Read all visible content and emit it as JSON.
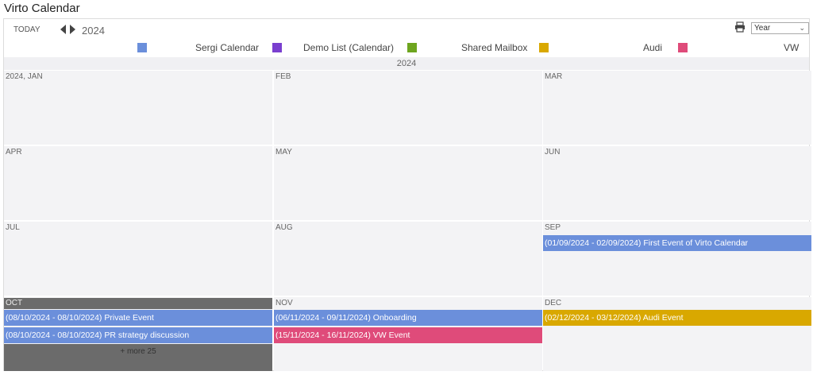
{
  "app": {
    "title": "Virto Calendar"
  },
  "toolbar": {
    "today_label": "TODAY",
    "year": "2024",
    "view_selected": "Year"
  },
  "legend": [
    {
      "label": "Sergi Calendar",
      "color": "#6b8fdb"
    },
    {
      "label": "Demo List (Calendar)",
      "color": "#7a3fcf"
    },
    {
      "label": "Shared Mailbox",
      "color": "#6ea51f"
    },
    {
      "label": "Audi",
      "color": "#d9a800"
    },
    {
      "label": "VW",
      "color": "#df4b7a"
    }
  ],
  "year_header": "2024",
  "months": [
    {
      "label": "2024, JAN"
    },
    {
      "label": "FEB"
    },
    {
      "label": "MAR"
    },
    {
      "label": "APR"
    },
    {
      "label": "MAY"
    },
    {
      "label": "JUN"
    },
    {
      "label": "JUL"
    },
    {
      "label": "AUG"
    },
    {
      "label": "SEP"
    },
    {
      "label": "OCT"
    },
    {
      "label": "NOV"
    },
    {
      "label": "DEC"
    }
  ],
  "events": {
    "sep": [
      {
        "dates": "(01/09/2024 - 02/09/2024)",
        "title": "First Event of Virto Calendar",
        "color": "#6b8fdb"
      }
    ],
    "oct": [
      {
        "dates": "(08/10/2024 - 08/10/2024)",
        "title": "Private Event",
        "color": "#6b8fdb"
      },
      {
        "dates": "(08/10/2024 - 08/10/2024)",
        "title": "PR strategy discussion",
        "color": "#6b8fdb"
      }
    ],
    "nov": [
      {
        "dates": "(06/11/2024 - 09/11/2024)",
        "title": "Onboarding",
        "color": "#6b8fdb"
      },
      {
        "dates": "(15/11/2024 - 16/11/2024)",
        "title": "VW Event",
        "color": "#df4b7a"
      }
    ],
    "dec": [
      {
        "dates": "(02/12/2024 - 03/12/2024)",
        "title": "Audi Event",
        "color": "#d9a800"
      }
    ]
  },
  "oct_more": "+ more 25"
}
